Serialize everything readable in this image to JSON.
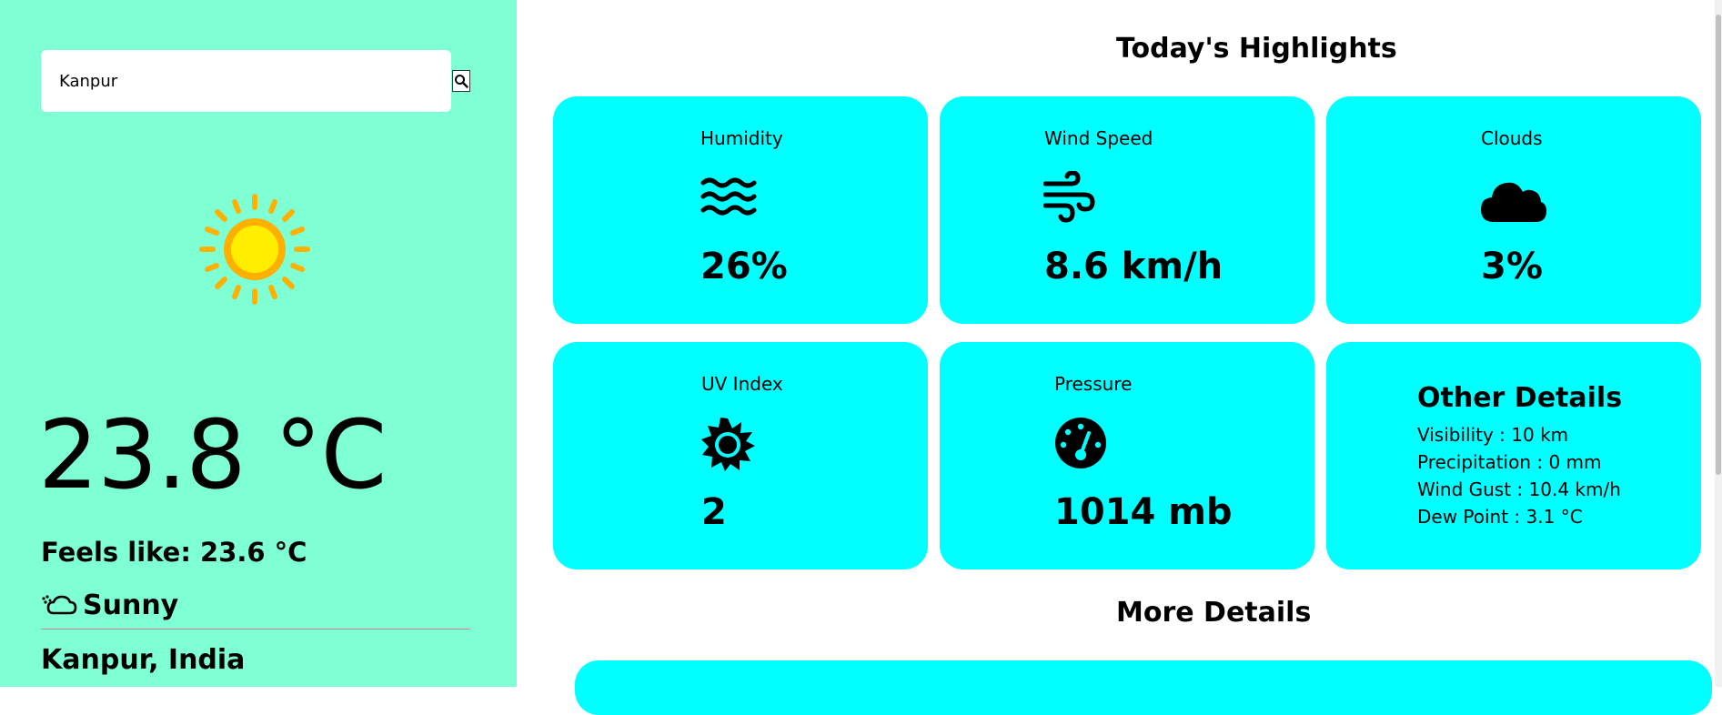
{
  "search": {
    "value": "Kanpur"
  },
  "current": {
    "temperature": "23.8 °C",
    "feels_like": "Feels like: 23.6 °C",
    "condition": "Sunny",
    "location": "Kanpur, India"
  },
  "highlights": {
    "title": "Today's Highlights",
    "humidity": {
      "label": "Humidity",
      "value": "26%",
      "icon": "water-waves-icon"
    },
    "wind": {
      "label": "Wind Speed",
      "value": "8.6 km/h",
      "icon": "wind-icon"
    },
    "clouds": {
      "label": "Clouds",
      "value": "3%",
      "icon": "cloud-icon"
    },
    "uv": {
      "label": "UV Index",
      "value": "2",
      "icon": "sun-icon"
    },
    "pressure": {
      "label": "Pressure",
      "value": "1014 mb",
      "icon": "gauge-icon"
    },
    "other": {
      "title": "Other Details",
      "visibility": "Visibility : 10 km",
      "precipitation": "Precipitation : 0 mm",
      "wind_gust": "Wind Gust : 10.4 km/h",
      "dew_point": "Dew Point : 3.1 °C"
    }
  },
  "more": {
    "title": "More Details"
  },
  "colors": {
    "sidebar_bg": "#7fffd4",
    "card_bg": "#00ffff",
    "sun_core": "#ffee00",
    "sun_rays": "#ffb000"
  }
}
